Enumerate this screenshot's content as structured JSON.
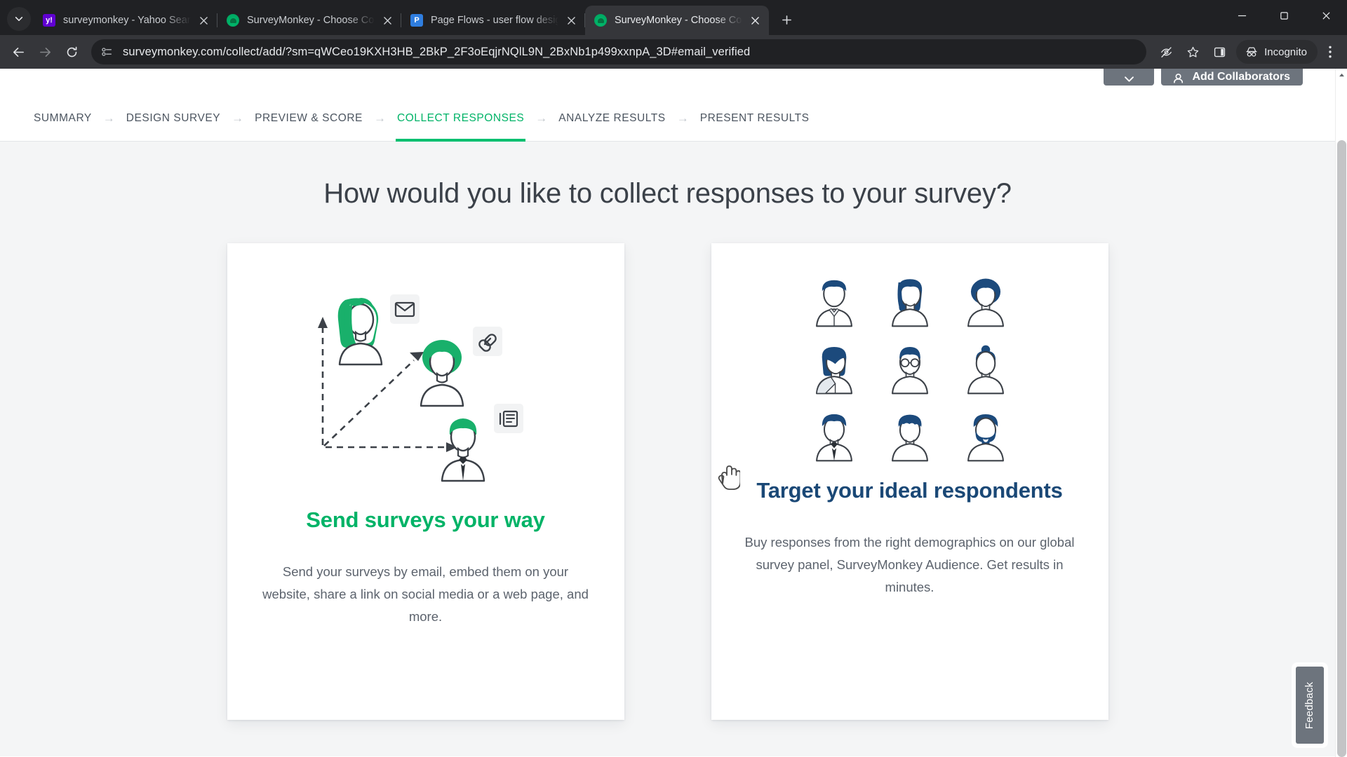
{
  "browser": {
    "tabs": [
      {
        "title": "surveymonkey - Yahoo Search Results",
        "favicon": "yahoo-icon",
        "active": false
      },
      {
        "title": "SurveyMonkey - Choose Collector",
        "favicon": "surveymonkey-icon",
        "active": false
      },
      {
        "title": "Page Flows - user flow design inspiration",
        "favicon": "pageflows-icon",
        "active": false
      },
      {
        "title": "SurveyMonkey - Choose Collector",
        "favicon": "surveymonkey-icon",
        "active": true
      }
    ],
    "new_tab_label": "+",
    "url": "surveymonkey.com/collect/add/?sm=qWCeo19KXH3HB_2BkP_2F3oEqjrNQlL9N_2BxNb1p499xxnpA_3D#email_verified",
    "incognito_label": "Incognito",
    "window_controls": {
      "minimize": "minimize",
      "maximize": "maximize",
      "close": "close"
    },
    "toolbar_icons": [
      "back-icon",
      "forward-icon",
      "reload-icon",
      "site-info-icon",
      "tracking-protection-icon",
      "bookmark-star-icon",
      "side-panel-icon",
      "incognito-icon",
      "browser-menu-icon"
    ]
  },
  "app_header": {
    "chevron_label": "",
    "add_collaborators_label": "Add Collaborators"
  },
  "stepnav": {
    "arrow_glyph": "→",
    "steps": [
      {
        "label": "SUMMARY",
        "active": false
      },
      {
        "label": "DESIGN SURVEY",
        "active": false
      },
      {
        "label": "PREVIEW & SCORE",
        "active": false
      },
      {
        "label": "COLLECT RESPONSES",
        "active": true
      },
      {
        "label": "ANALYZE RESULTS",
        "active": false
      },
      {
        "label": "PRESENT RESULTS",
        "active": false
      }
    ]
  },
  "main": {
    "page_title": "How would you like to collect responses to your survey?",
    "cards": [
      {
        "id": "send-surveys-your-way",
        "heading": "Send surveys your way",
        "description": "Send your surveys by email, embed them on your website, share a link on social media or a web page, and more.",
        "accent_color": "#00b367",
        "illustration": "people-chart-email-link-form-illustration"
      },
      {
        "id": "target-your-ideal-respondents",
        "heading": "Target your ideal respondents",
        "description": "Buy responses from the right demographics on our global survey panel, SurveyMonkey Audience. Get results in minutes.",
        "accent_color": "#1a4876",
        "illustration": "nine-avatars-grid-illustration"
      }
    ]
  },
  "feedback": {
    "label": "Feedback"
  },
  "colors": {
    "brand_green": "#00bf6f",
    "navy": "#1a4876",
    "page_bg": "#f4f5f6",
    "chrome_bg": "#202124",
    "toolbar_bg": "#35363a",
    "muted_text": "#5c636d"
  }
}
